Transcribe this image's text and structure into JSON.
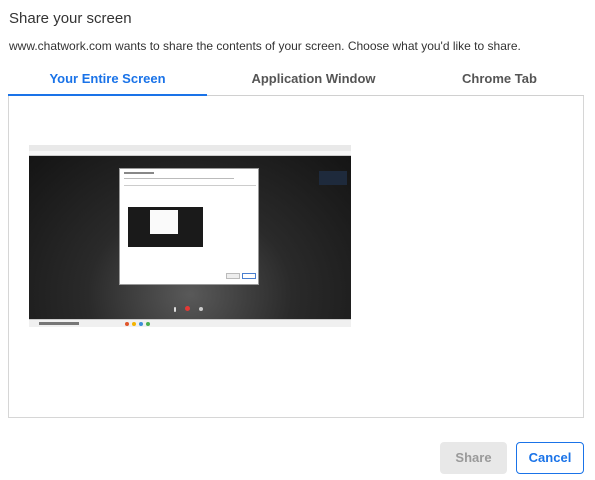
{
  "dialog": {
    "title": "Share your screen",
    "description": "www.chatwork.com wants to share the contents of your screen. Choose what you'd like to share."
  },
  "tabs": [
    {
      "label": "Your Entire Screen",
      "active": true
    },
    {
      "label": "Application Window",
      "active": false
    },
    {
      "label": "Chrome Tab",
      "active": false
    }
  ],
  "buttons": {
    "share_label": "Share",
    "cancel_label": "Cancel"
  },
  "colors": {
    "accent": "#1a73e8",
    "disabled_button_bg": "#e8e8e8",
    "disabled_button_text": "#9a9a9a"
  }
}
